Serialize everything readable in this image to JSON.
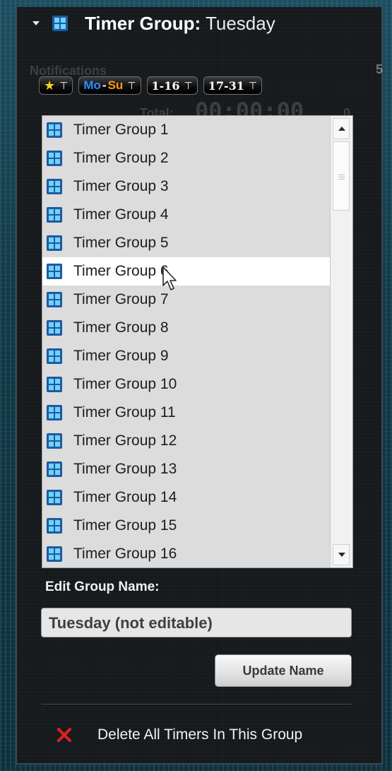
{
  "header": {
    "title_label": "Timer Group:",
    "title_value": "Tuesday",
    "icon": "grid-icon"
  },
  "background_ghost": {
    "notifications": "Notifications",
    "total_label": "Total:",
    "total_value": "00:00:00",
    "digit_right": "5",
    "digit_right2": "0"
  },
  "filters": {
    "favorites_icon": "star-icon",
    "weekday_from": "Mo",
    "weekday_sep": "-",
    "weekday_to": "Su",
    "range1": "1-16",
    "range2": "17-31",
    "pin_glyph": "⏋"
  },
  "list": {
    "items": [
      "Timer Group 1",
      "Timer Group 2",
      "Timer Group 3",
      "Timer Group 4",
      "Timer Group 5",
      "Timer Group 6",
      "Timer Group 7",
      "Timer Group 8",
      "Timer Group 9",
      "Timer Group 10",
      "Timer Group 11",
      "Timer Group 12",
      "Timer Group 13",
      "Timer Group 14",
      "Timer Group 15",
      "Timer Group 16"
    ],
    "hovered_index": 5
  },
  "edit": {
    "label": "Edit Group Name:",
    "value": "Tuesday (not editable)"
  },
  "update_button": "Update Name",
  "delete_label": "Delete All Timers In This Group",
  "colors": {
    "accent_blue": "#2f8fff",
    "accent_orange": "#ff9a1a",
    "star_yellow": "#ffd21a",
    "delete_red": "#e02020"
  }
}
